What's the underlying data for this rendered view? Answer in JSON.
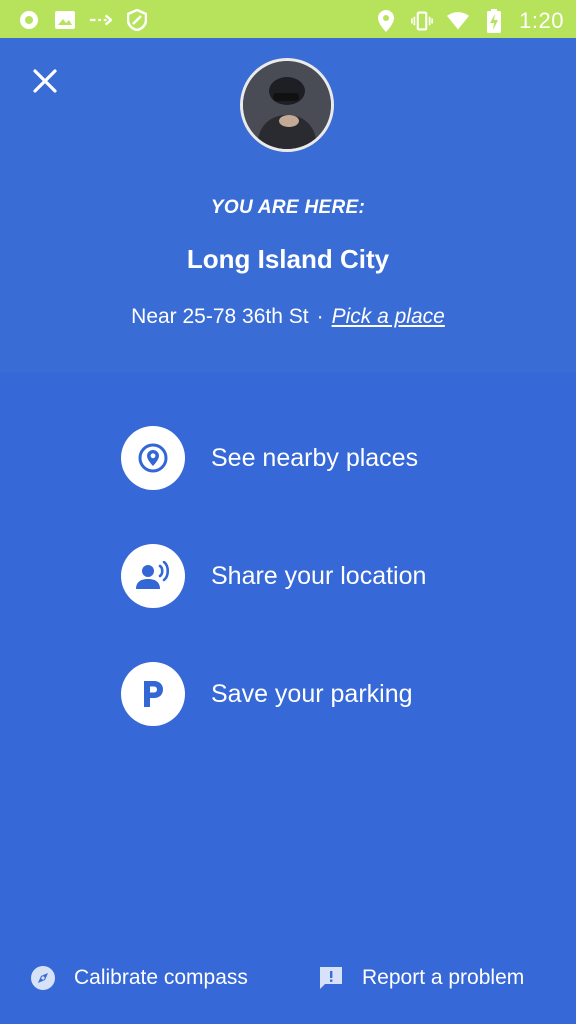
{
  "status_bar": {
    "time": "1:20",
    "left_icons": [
      "settings-icon",
      "image-icon",
      "data-saver-icon",
      "vpn-icon"
    ],
    "right_icons": [
      "location-icon",
      "vibrate-icon",
      "wifi-icon",
      "battery-charging-icon"
    ]
  },
  "header": {
    "you_are_here": "YOU ARE HERE:",
    "place_title": "Long Island City",
    "near_text": "Near 25-78 36th St",
    "separator": "·",
    "pick_place": "Pick a place"
  },
  "actions": [
    {
      "label": "See nearby places",
      "icon": "place-pin-icon"
    },
    {
      "label": "Share your location",
      "icon": "share-location-icon"
    },
    {
      "label": "Save your parking",
      "icon": "parking-icon"
    }
  ],
  "footer": {
    "calibrate": "Calibrate compass",
    "report": "Report a problem"
  },
  "colors": {
    "status_bar": "#b6e35b",
    "panel": "#3a6cd6",
    "accent": "#3367d6"
  }
}
